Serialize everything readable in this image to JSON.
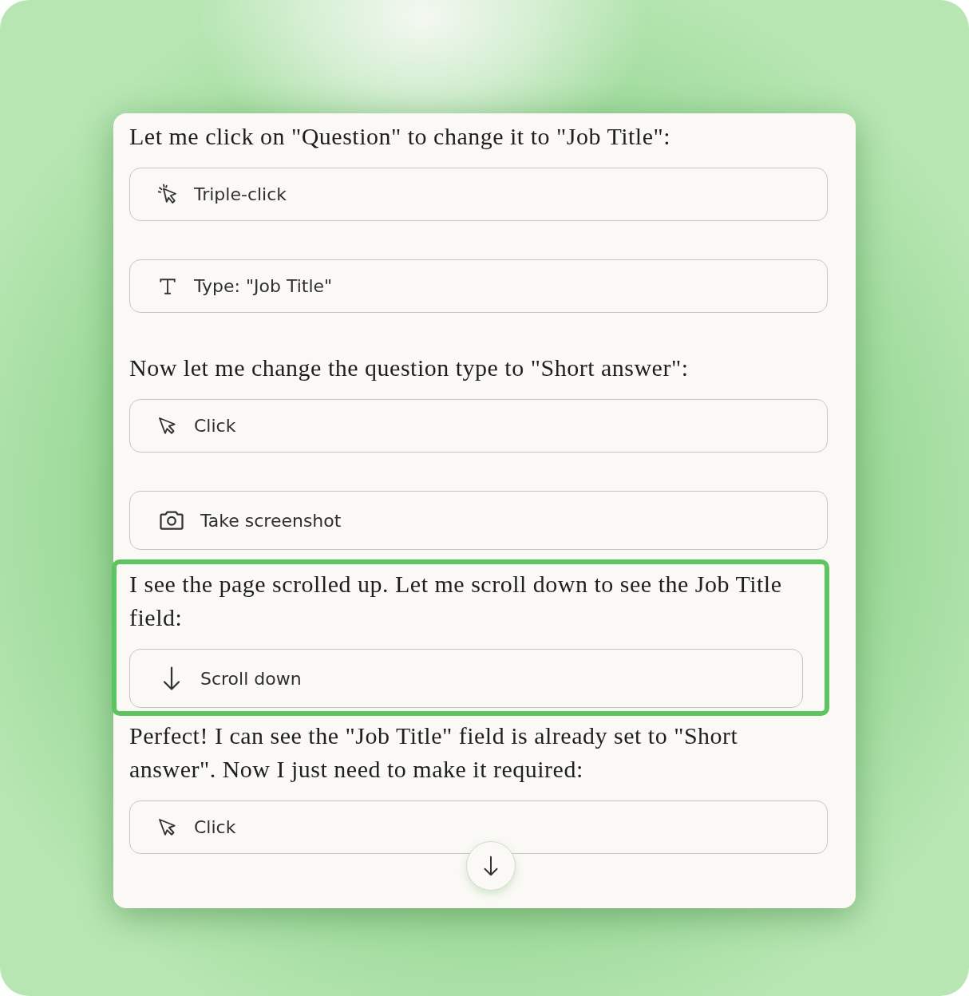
{
  "blocks": [
    {
      "highlighted": false,
      "items": [
        {
          "kind": "text",
          "text": "Let me click on \"Question\" to change it to \"Job Title\":"
        },
        {
          "kind": "triple-click",
          "label": "Triple-click"
        },
        {
          "kind": "type",
          "label": "Type: \"Job Title\""
        },
        {
          "kind": "text",
          "text": "Now let me change the question type to \"Short answer\":"
        },
        {
          "kind": "click",
          "label": "Click"
        },
        {
          "kind": "screenshot",
          "label": "Take screenshot"
        }
      ]
    },
    {
      "highlighted": true,
      "items": [
        {
          "kind": "text",
          "text": "I see the page scrolled up. Let me scroll down to see the Job Title field:"
        },
        {
          "kind": "scroll",
          "label": "Scroll down"
        }
      ]
    },
    {
      "highlighted": false,
      "items": [
        {
          "kind": "text",
          "text": "Perfect! I can see the \"Job Title\" field is already set to \"Short answer\". Now I just need to make it required:"
        },
        {
          "kind": "click",
          "label": "Click"
        }
      ]
    }
  ]
}
